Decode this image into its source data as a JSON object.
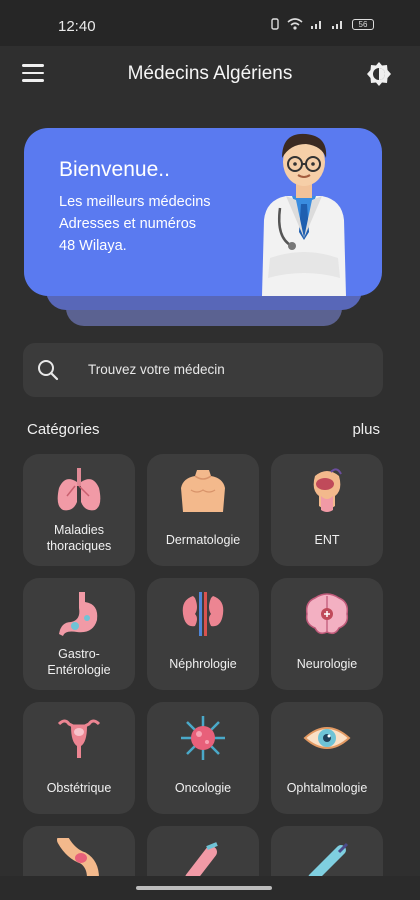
{
  "status_bar": {
    "time": "12:40",
    "battery": "56"
  },
  "app_bar": {
    "title": "Médecins Algériens",
    "menu_icon": "hamburger-menu-icon",
    "theme_icon": "theme-toggle-icon"
  },
  "banner": {
    "greeting": "Bienvenue..",
    "line1": "Les meilleurs médecins",
    "line2": "Adresses et numéros",
    "line3": "48 Wilaya.",
    "color": "#5a7af0"
  },
  "search": {
    "placeholder": "Trouvez votre médecin"
  },
  "categories": {
    "label": "Catégories",
    "more": "plus",
    "items": [
      {
        "name": "Maladies thoraciques",
        "line1": "Maladies",
        "line2": "thoraciques",
        "icon": "lungs-icon"
      },
      {
        "name": "Dermatologie",
        "line1": "Dermatologie",
        "line2": "",
        "icon": "torso-skin-icon"
      },
      {
        "name": "ENT",
        "line1": "ENT",
        "line2": "",
        "icon": "ear-nose-throat-icon"
      },
      {
        "name": "Gastro-Entérologie",
        "line1": "Gastro-",
        "line2": "Entérologie",
        "icon": "stomach-icon"
      },
      {
        "name": "Néphrologie",
        "line1": "Néphrologie",
        "line2": "",
        "icon": "kidneys-icon"
      },
      {
        "name": "Neurologie",
        "line1": "Neurologie",
        "line2": "",
        "icon": "brain-icon"
      },
      {
        "name": "Obstétrique",
        "line1": "Obstétrique",
        "line2": "",
        "icon": "uterus-icon"
      },
      {
        "name": "Oncologie",
        "line1": "Oncologie",
        "line2": "",
        "icon": "cancer-cell-icon"
      },
      {
        "name": "Ophtalmologie",
        "line1": "Ophtalmologie",
        "line2": "",
        "icon": "eye-icon"
      },
      {
        "name": "",
        "line1": "",
        "line2": "",
        "icon": "knee-joint-icon"
      },
      {
        "name": "",
        "line1": "",
        "line2": "",
        "icon": "limb-icon"
      },
      {
        "name": "",
        "line1": "",
        "line2": "",
        "icon": "syringe-icon"
      }
    ]
  }
}
